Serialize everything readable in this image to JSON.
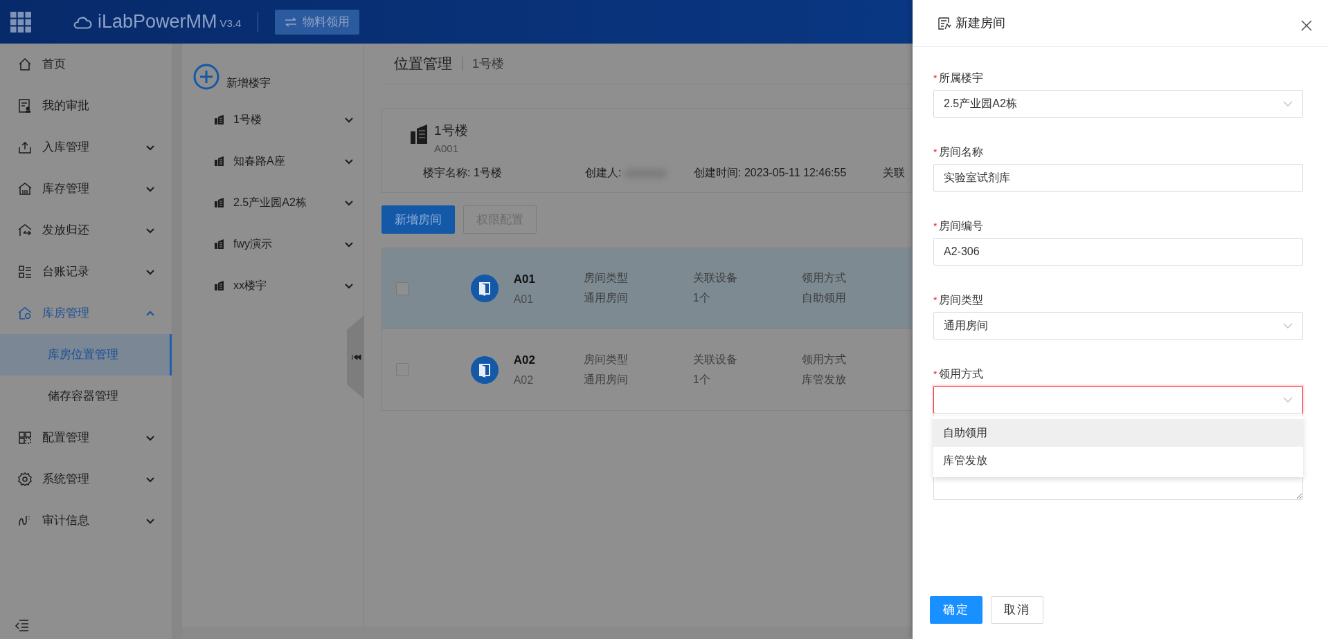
{
  "header": {
    "logo": "iLabPowerMM",
    "version": "V3.4",
    "switch_button": "物料领用"
  },
  "sidebar": {
    "items": [
      {
        "label": "首页",
        "kind": "link",
        "selected": false
      },
      {
        "label": "我的审批",
        "kind": "link",
        "selected": false
      },
      {
        "label": "入库管理",
        "kind": "group",
        "selected": false,
        "expanded": false
      },
      {
        "label": "库存管理",
        "kind": "group",
        "selected": false,
        "expanded": false
      },
      {
        "label": "发放归还",
        "kind": "group",
        "selected": false,
        "expanded": false
      },
      {
        "label": "台账记录",
        "kind": "group",
        "selected": false,
        "expanded": false
      },
      {
        "label": "库房管理",
        "kind": "group",
        "selected": true,
        "expanded": true,
        "children": [
          {
            "label": "库房位置管理",
            "selected": true
          },
          {
            "label": "储存容器管理",
            "selected": false
          }
        ]
      },
      {
        "label": "配置管理",
        "kind": "group",
        "selected": false,
        "expanded": false
      },
      {
        "label": "系统管理",
        "kind": "group",
        "selected": false,
        "expanded": false
      },
      {
        "label": "审计信息",
        "kind": "group",
        "selected": false,
        "expanded": false
      }
    ]
  },
  "buildings": {
    "add_label": "新增楼宇",
    "items": [
      {
        "name": "1号楼",
        "expanded": false
      },
      {
        "name": "知春路A座",
        "expanded": false
      },
      {
        "name": "2.5产业园A2栋",
        "expanded": false
      },
      {
        "name": "fwy演示",
        "expanded": false
      },
      {
        "name": "xx楼宇",
        "expanded": false
      }
    ]
  },
  "main": {
    "breadcrumb": [
      "位置管理",
      "1号楼"
    ],
    "building": {
      "name": "1号楼",
      "code": "A001",
      "fields": [
        {
          "text": "楼宇名称: 1号楼",
          "redacted": false
        },
        {
          "text": "创建人:",
          "redacted": true
        },
        {
          "text": "创建时间: 2023-05-11 12:46:55",
          "redacted": false
        },
        {
          "text": "关联",
          "redacted": false
        }
      ]
    },
    "buttons": [
      {
        "label": "新增房间",
        "disabled": false
      },
      {
        "label": "权限配置",
        "disabled": true
      }
    ],
    "rooms": [
      {
        "name": "A01",
        "code": "A01",
        "selected": true,
        "checked": false,
        "columns": [
          {
            "label": "房间类型",
            "value": "通用房间"
          },
          {
            "label": "关联设备",
            "value": "1个"
          },
          {
            "label": "领用方式",
            "value": "自助领用"
          }
        ]
      },
      {
        "name": "A02",
        "code": "A02",
        "selected": false,
        "checked": false,
        "columns": [
          {
            "label": "房间类型",
            "value": "通用房间"
          },
          {
            "label": "关联设备",
            "value": "1个"
          },
          {
            "label": "领用方式",
            "value": "库管发放"
          }
        ]
      }
    ]
  },
  "drawer": {
    "title": "新建房间",
    "fields": [
      {
        "kind": "select",
        "required_mark": "*",
        "label": "所属楼宇",
        "value": "2.5产业园A2栋",
        "error": false
      },
      {
        "kind": "input",
        "required_mark": "*",
        "label": "房间名称",
        "value": "实验室试剂库",
        "error": false
      },
      {
        "kind": "input",
        "required_mark": "*",
        "label": "房间编号",
        "value": "A2-306",
        "error": false
      },
      {
        "kind": "select",
        "required_mark": "*",
        "label": "房间类型",
        "value": "通用房间",
        "error": false
      },
      {
        "kind": "select",
        "required_mark": "*",
        "label": "领用方式",
        "error": true,
        "open": true,
        "options": [
          {
            "label": "自助领用",
            "hovered": true
          },
          {
            "label": "库管发放",
            "hovered": false
          }
        ]
      },
      {
        "kind": "textarea",
        "error": false
      }
    ],
    "buttons": [
      {
        "label": "确定",
        "primary": true
      },
      {
        "label": "取消",
        "primary": false
      }
    ]
  }
}
